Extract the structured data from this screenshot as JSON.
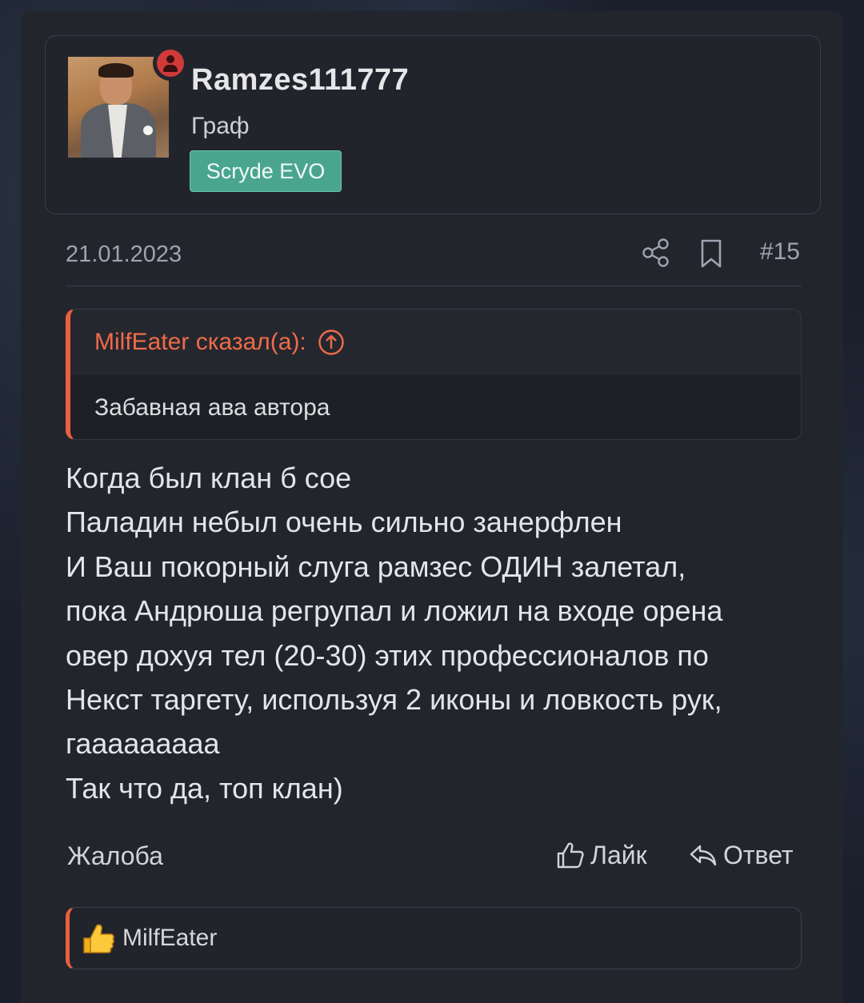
{
  "author": {
    "username": "Ramzes111777",
    "title": "Граф",
    "badge": "Scryde EVO"
  },
  "meta": {
    "date": "21.01.2023",
    "post_number": "#15"
  },
  "quote": {
    "author_label": "MilfEater сказал(а):",
    "text": "Забавная ава автора"
  },
  "message": {
    "lines": [
      "Когда был клан б сое",
      "Паладин небыл очень сильно занерфлен",
      "И Ваш покорный слуга рамзес ОДИН залетал,",
      "пока Андрюша регрупал и ложил на входе орена",
      "овер дохуя тел (20-30) этих профессионалов по",
      "Некст таргету, используя 2 иконы и ловкость рук,",
      "гааааааааа",
      "Так что да, топ клан)"
    ]
  },
  "actions": {
    "report_label": "Жалоба",
    "like_label": "Лайк",
    "reply_label": "Ответ"
  },
  "reactions": {
    "users": [
      "MilfEater"
    ]
  },
  "colors": {
    "accent": "#e9603f",
    "badge": "#4aa58e",
    "status": "#d23a3a"
  }
}
